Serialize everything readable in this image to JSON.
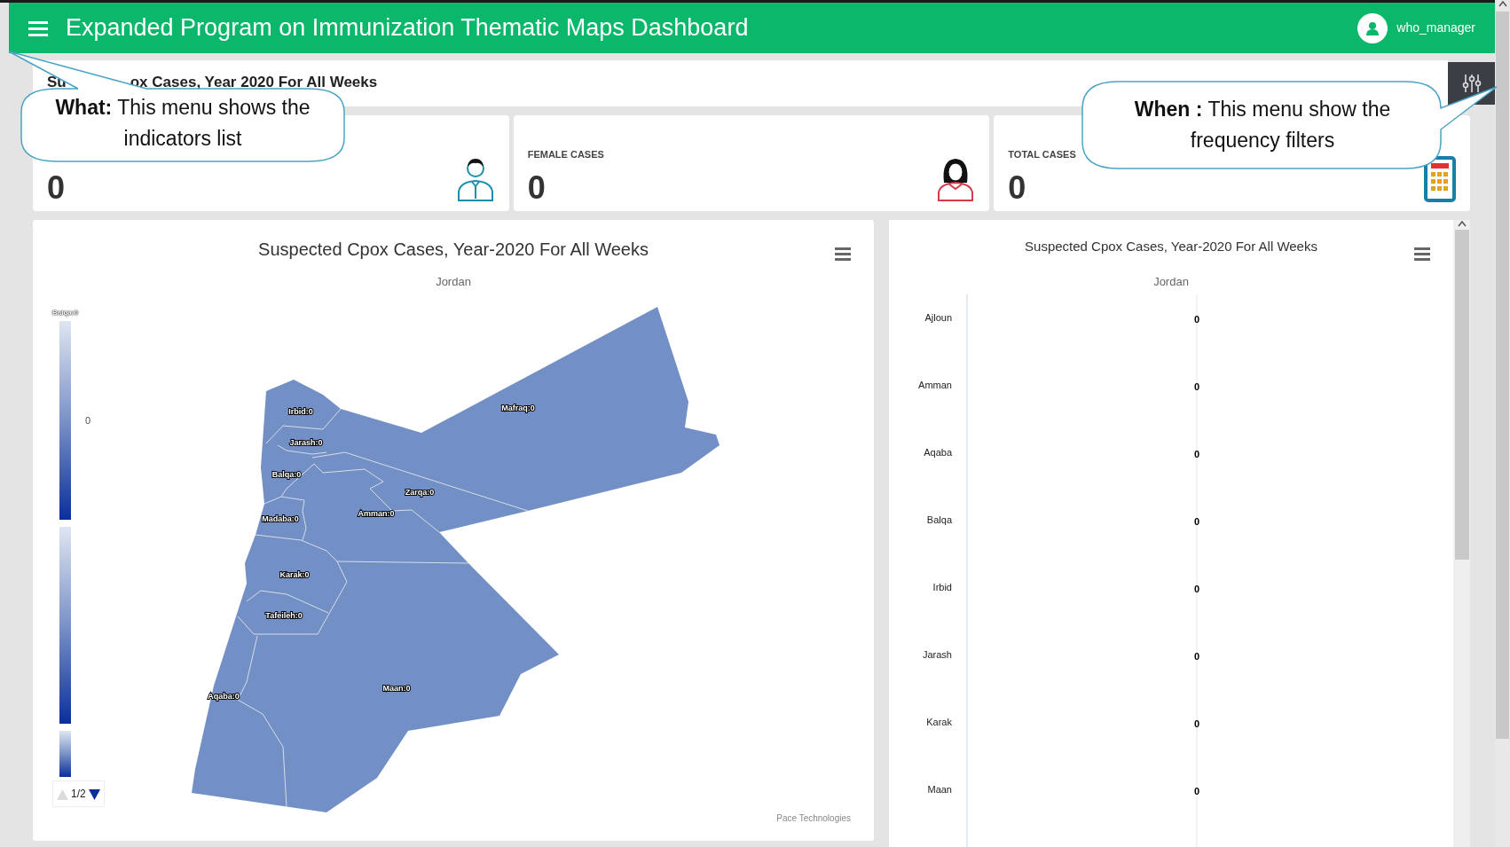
{
  "header": {
    "title": "Expanded Program on Immunization Thematic Maps Dashboard",
    "user": "who_manager"
  },
  "indicator_bar": {
    "text_parts": [
      "Su",
      "ox Cases, Year 2020 For All Weeks"
    ]
  },
  "stat_cards": [
    {
      "kind": "male",
      "value": "0"
    },
    {
      "kind": "female",
      "label": "FEMALE CASES",
      "value": "0"
    },
    {
      "kind": "total",
      "label": "TOTAL CASES",
      "value": "0"
    }
  ],
  "map_panel": {
    "title": "Suspected Cpox Cases, Year-2020 For All Weeks",
    "subtitle": "Jordan",
    "legend": {
      "top_label": "Balqa:0",
      "tick": "0",
      "page": "1/2",
      "up_disabled": true,
      "down_disabled": false
    },
    "regions": [
      {
        "label": "Irbid:0"
      },
      {
        "label": "Jarash:0"
      },
      {
        "label": "Balqa:0"
      },
      {
        "label": "Madaba:0"
      },
      {
        "label": "Amman:0"
      },
      {
        "label": "Zarqa:0"
      },
      {
        "label": "Mafraq:0"
      },
      {
        "label": "Karak:0"
      },
      {
        "label": "Tafeileh:0"
      },
      {
        "label": "Maan:0"
      },
      {
        "label": "Aqaba:0"
      }
    ],
    "credits": "Pace Technologies"
  },
  "bar_panel": {
    "title": "Suspected Cpox Cases, Year-2020 For All Weeks",
    "subtitle": "Jordan",
    "rows": [
      {
        "label": "Ajloun",
        "value": "0"
      },
      {
        "label": "Amman",
        "value": "0"
      },
      {
        "label": "Aqaba",
        "value": "0"
      },
      {
        "label": "Balqa",
        "value": "0"
      },
      {
        "label": "Irbid",
        "value": "0"
      },
      {
        "label": "Jarash",
        "value": "0"
      },
      {
        "label": "Karak",
        "value": "0"
      },
      {
        "label": "Maan",
        "value": "0"
      }
    ]
  },
  "callouts": [
    {
      "text": "**What:** This menu shows the indicators list"
    },
    {
      "text": "**When :** This menu show the frequency filters"
    }
  ]
}
